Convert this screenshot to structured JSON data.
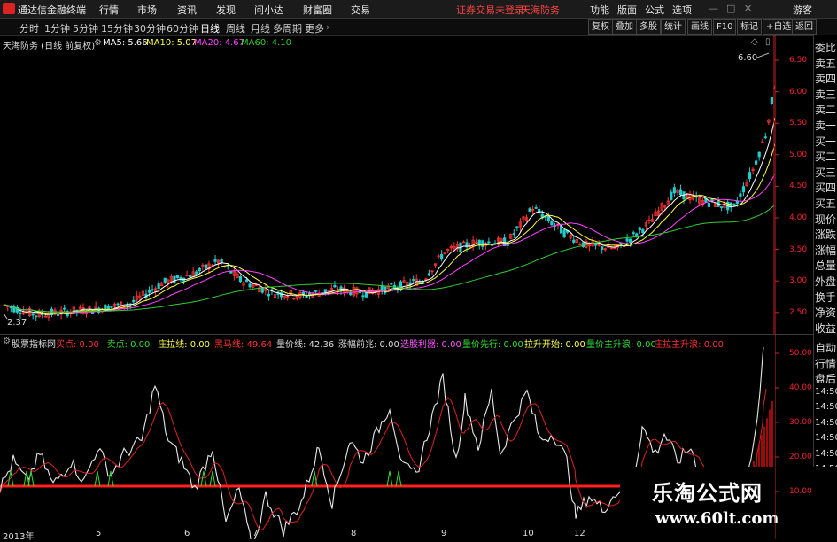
{
  "menubar": {
    "app_title": "通达信金融终端",
    "items": [
      "行情",
      "市场",
      "资讯",
      "发现",
      "问小达",
      "财富圈",
      "交易"
    ],
    "notice": "证券交易未登录",
    "stock_name": "天海防务",
    "right_items": [
      "功能",
      "版面",
      "公式",
      "选项"
    ],
    "account": "游客"
  },
  "toolbar": {
    "periods": [
      "分时",
      "1分钟",
      "5分钟",
      "15分钟",
      "30分钟",
      "60分钟",
      "日线",
      "周线",
      "月线",
      "多周期",
      "更多"
    ],
    "active_period": "日线",
    "buttons": [
      "复权",
      "叠加",
      "多股",
      "统计",
      "画线",
      "F10",
      "标记",
      "+自选",
      "返回"
    ]
  },
  "main_info": {
    "title": "天海防务 (日线 前复权)",
    "ma5": "MA5: 5.66",
    "ma10": "MA10: 5.07",
    "ma20": "MA20: 4.67",
    "ma60": "MA60: 4.10",
    "high_label": "6.60",
    "low_label": "2.37"
  },
  "main_axis": [
    "6.50",
    "6.00",
    "5.50",
    "5.00",
    "4.50",
    "4.00",
    "3.50",
    "3.00",
    "2.50"
  ],
  "sub_info": {
    "title": "股票指标网",
    "items": [
      {
        "label": "买点: 0.00",
        "color": "#ff3333"
      },
      {
        "label": "卖点: 0.00",
        "color": "#33dd33"
      },
      {
        "label": "庄拉线: 0.00",
        "color": "#ffff55"
      },
      {
        "label": "黑马线: 49.64",
        "color": "#ff3333"
      },
      {
        "label": "量价线: 42.36",
        "color": "#dddddd"
      },
      {
        "label": "涨幅前兆: 0.00",
        "color": "#dddddd"
      },
      {
        "label": "选股利器: 0.00",
        "color": "#ff55ff"
      },
      {
        "label": "量价先行: 0.00",
        "color": "#33dd33"
      },
      {
        "label": "拉升开始: 0.00",
        "color": "#ffff55"
      },
      {
        "label": "量价主升浪: 0.00",
        "color": "#33dd33"
      },
      {
        "label": "庄拉主升浪: 0.00",
        "color": "#ff3333"
      }
    ]
  },
  "sub_axis": [
    "50.00",
    "40.00",
    "30.00",
    "20.00",
    "10.00"
  ],
  "x_axis": [
    "2013年",
    "5",
    "6",
    "7",
    "8",
    "9",
    "10",
    "12"
  ],
  "right_panel": [
    "委比",
    "卖五",
    "卖四",
    "卖三",
    "卖二",
    "卖一",
    "买一",
    "买二",
    "买三",
    "买四",
    "买五",
    "现价",
    "涨跌",
    "涨幅",
    "总量",
    "外盘",
    "换手",
    "净资",
    "收益"
  ],
  "right_panel_lower": [
    "自动",
    "行情",
    "盘后",
    "14:50",
    "14:50",
    "14:50",
    "14:50",
    "14:50",
    "14:50"
  ],
  "watermark": {
    "title": "乐淘公式网",
    "url": "www.60lt.com"
  },
  "colors": {
    "up": "#ff3333",
    "down": "#22cccc",
    "ma5": "#ffffff",
    "ma10": "#ffff44",
    "ma20": "#ff44ff",
    "ma60": "#33cc33"
  }
}
